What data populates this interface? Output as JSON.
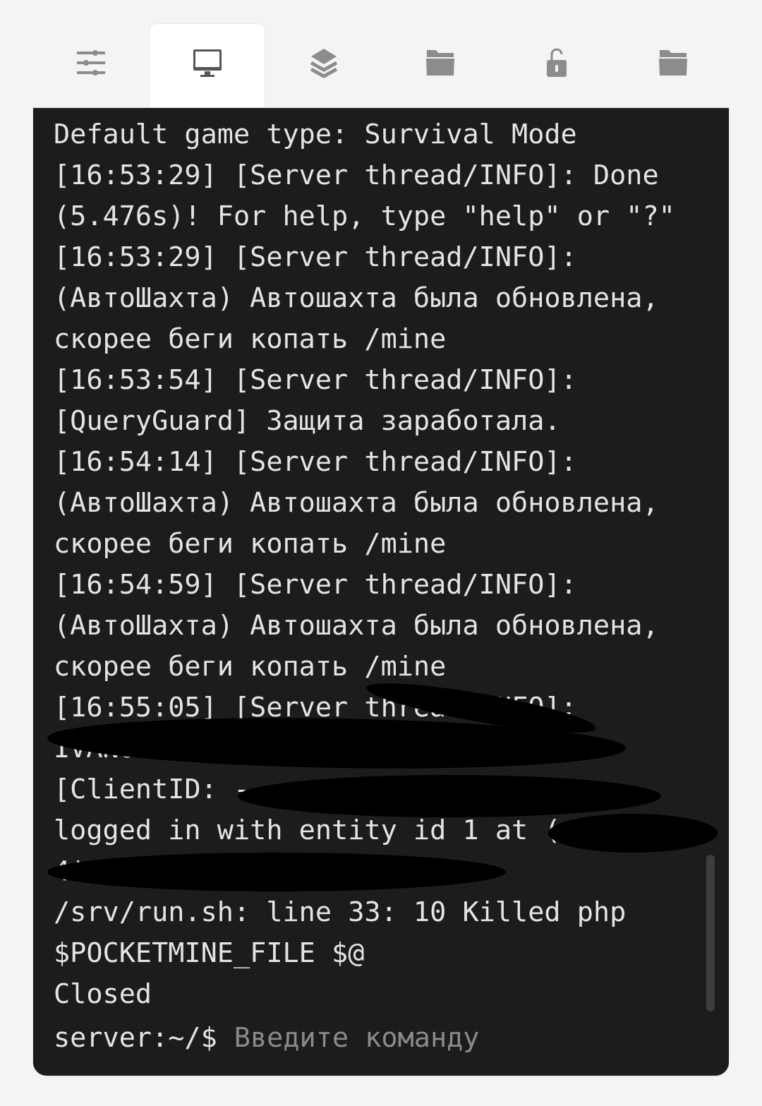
{
  "tabs": [
    {
      "icon": "sliders-icon",
      "active": false
    },
    {
      "icon": "monitor-icon",
      "active": true
    },
    {
      "icon": "layers-icon",
      "active": false
    },
    {
      "icon": "folder-icon",
      "active": false
    },
    {
      "icon": "unlock-icon",
      "active": false
    },
    {
      "icon": "folder-icon",
      "active": false
    }
  ],
  "console": {
    "lines": [
      "Default game type: Survival Mode",
      "[16:53:29] [Server thread/INFO]: Done",
      "(5.476s)! For help, type \"help\" or \"?\"",
      "[16:53:29] [Server thread/INFO]:",
      "(АвтоШахта) Автошахта была обновлена,",
      "скорее беги копать /mine",
      "[16:53:54] [Server thread/INFO]:",
      "[QueryGuard] Защита заработала.",
      "[16:54:14] [Server thread/INFO]:",
      "(АвтоШахта) Автошахта была обновлена,",
      "скорее беги копать /mine",
      "[16:54:59] [Server thread/INFO]:",
      "(АвтоШахта) Автошахта была обновлена,",
      "скорее беги копать /mine",
      "[16:55:05] [Server thread/INFO]:",
      "IVANOV",
      "[ClientID: -",
      "logged in with entity id 1 at (",
      "4'",
      "/srv/run.sh: line 33: 10 Killed php",
      "$POCKETMINE_FILE $@",
      "Closed"
    ],
    "prompt": "server:~/$",
    "input_placeholder": "Введите команду",
    "input_value": ""
  },
  "colors": {
    "background": "#f4f4f4",
    "console_bg": "#1c1c1c",
    "text": "#e4e4e4",
    "icon": "#8c8c8c"
  }
}
